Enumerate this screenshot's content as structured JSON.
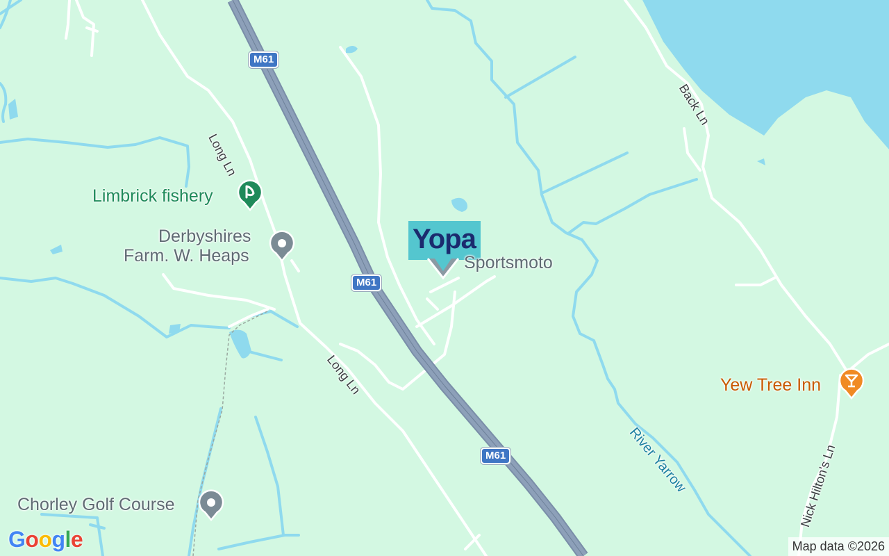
{
  "map": {
    "roads": {
      "motorway_label": "M61",
      "long_ln": "Long Ln",
      "back_ln": "Back Ln",
      "nick_hiltons_ln": "Nick Hilton's Ln"
    },
    "waterways": {
      "river_yarrow": "River Yarrow"
    },
    "places": {
      "limbrick_fishery": "Limbrick fishery",
      "derbyshires_line1": "Derbyshires",
      "derbyshires_line2": "Farm. W. Heaps",
      "sportsmoto": "Sportsmoto",
      "yew_tree_inn": "Yew Tree Inn",
      "chorley_golf_course": "Chorley Golf Course"
    },
    "marker": {
      "brand": "Yopa"
    },
    "colors": {
      "land": "#d3f8e2",
      "water": "#8fdaee",
      "motorway": "#8da0b9",
      "poi_green": "#1f8a5a",
      "poi_gray": "#7b8b95",
      "poi_orange": "#e8710a",
      "marker_bg": "#54c6cf",
      "marker_text": "#1b2a6e"
    }
  },
  "footer": {
    "logo": "Google",
    "attribution": "Map data ©2026"
  }
}
